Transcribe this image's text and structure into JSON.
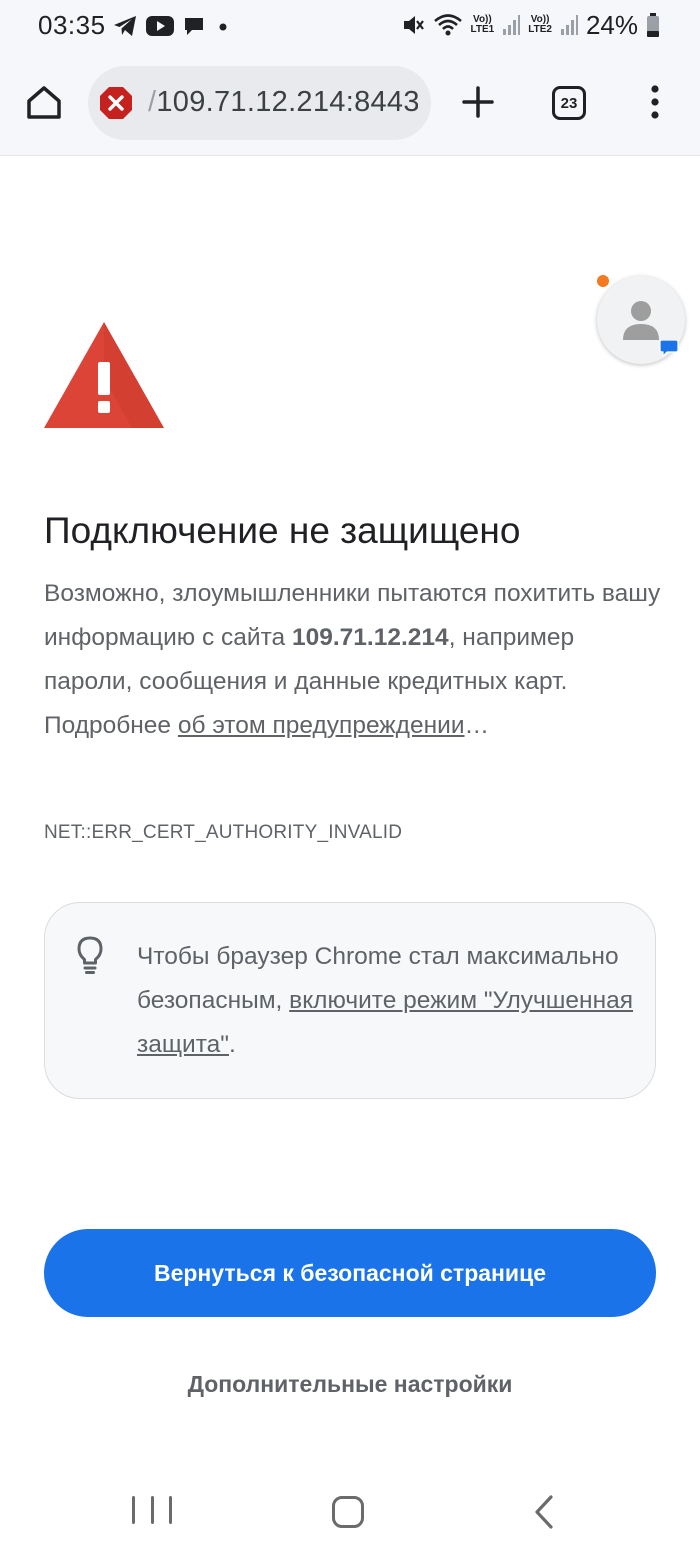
{
  "status_bar": {
    "time": "03:35",
    "battery": "24%",
    "sim1_tag_top": "Vo))",
    "sim1_tag_bottom": "LTE1",
    "sim2_tag_top": "Vo))",
    "sim2_tag_bottom": "LTE2",
    "icons": [
      "telegram-icon",
      "youtube-icon",
      "chat-icon",
      "dot-icon",
      "mute-icon",
      "wifi-icon",
      "signal-icon",
      "battery-icon"
    ]
  },
  "toolbar": {
    "url": "109.71.12.214:8443",
    "url_prefix_fragment": "/",
    "tab_count": "23",
    "icons": [
      "home-icon",
      "not-secure-icon",
      "plus-icon",
      "tabs-icon",
      "more-vert-icon"
    ]
  },
  "page": {
    "heading": "Подключение не защищено",
    "body_part1": "Возможно, злоумышленники пытаются похитить вашу информацию с сайта ",
    "body_host": "109.71.12.214",
    "body_part2": ", например пароли, сообщения и данные кредитных карт. Подробнее ",
    "body_link": "об этом предупреждении",
    "body_part3": "…",
    "error_code": "NET::ERR_CERT_AUTHORITY_INVALID",
    "tip_part1": "Чтобы браузер Chrome стал максимально безопасным, ",
    "tip_link": "включите режим \"Улучшенная защита\"",
    "tip_part2": ".",
    "primary_button": "Вернуться к безопасной странице",
    "secondary_button": "Дополнительные настройки"
  },
  "colors": {
    "accent": "#1a73e8",
    "warning_red": "#db4437",
    "notification_dot": "#f4791f",
    "text_secondary": "#5f6368"
  }
}
